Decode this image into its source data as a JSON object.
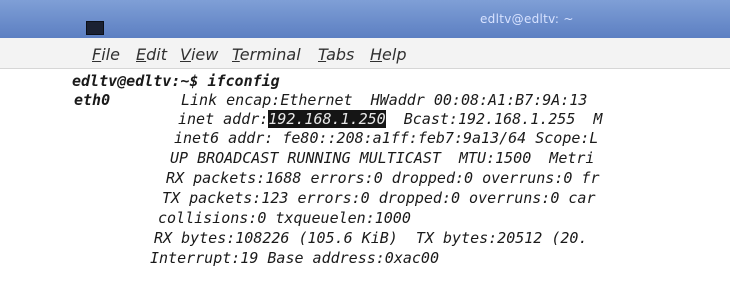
{
  "window": {
    "title": "edltv@edltv: ~"
  },
  "menu": [
    "File",
    "Edit",
    "View",
    "Terminal",
    "Tabs",
    "Help"
  ],
  "terminal": {
    "prompt": "edltv@edltv:~$ ifconfig",
    "iface": "eth0",
    "line1": "Link encap:Ethernet  HWaddr 00:08:A1:B7:9A:13",
    "line2_pre": "inet addr:",
    "line2_ip": "192.168.1.250",
    "line2_post": "  Bcast:192.168.1.255  M",
    "line3": "inet6 addr: fe80::208:a1ff:feb7:9a13/64 Scope:L",
    "line4": "UP BROADCAST RUNNING MULTICAST  MTU:1500  Metri",
    "line5": "RX packets:1688 errors:0 dropped:0 overruns:0 fr",
    "line6": "TX packets:123 errors:0 dropped:0 overruns:0 car",
    "line7": "collisions:0 txqueuelen:1000",
    "line8": "RX bytes:108226 (105.6 KiB)  TX bytes:20512 (20.",
    "line9": "Interrupt:19 Base address:0xac00"
  }
}
